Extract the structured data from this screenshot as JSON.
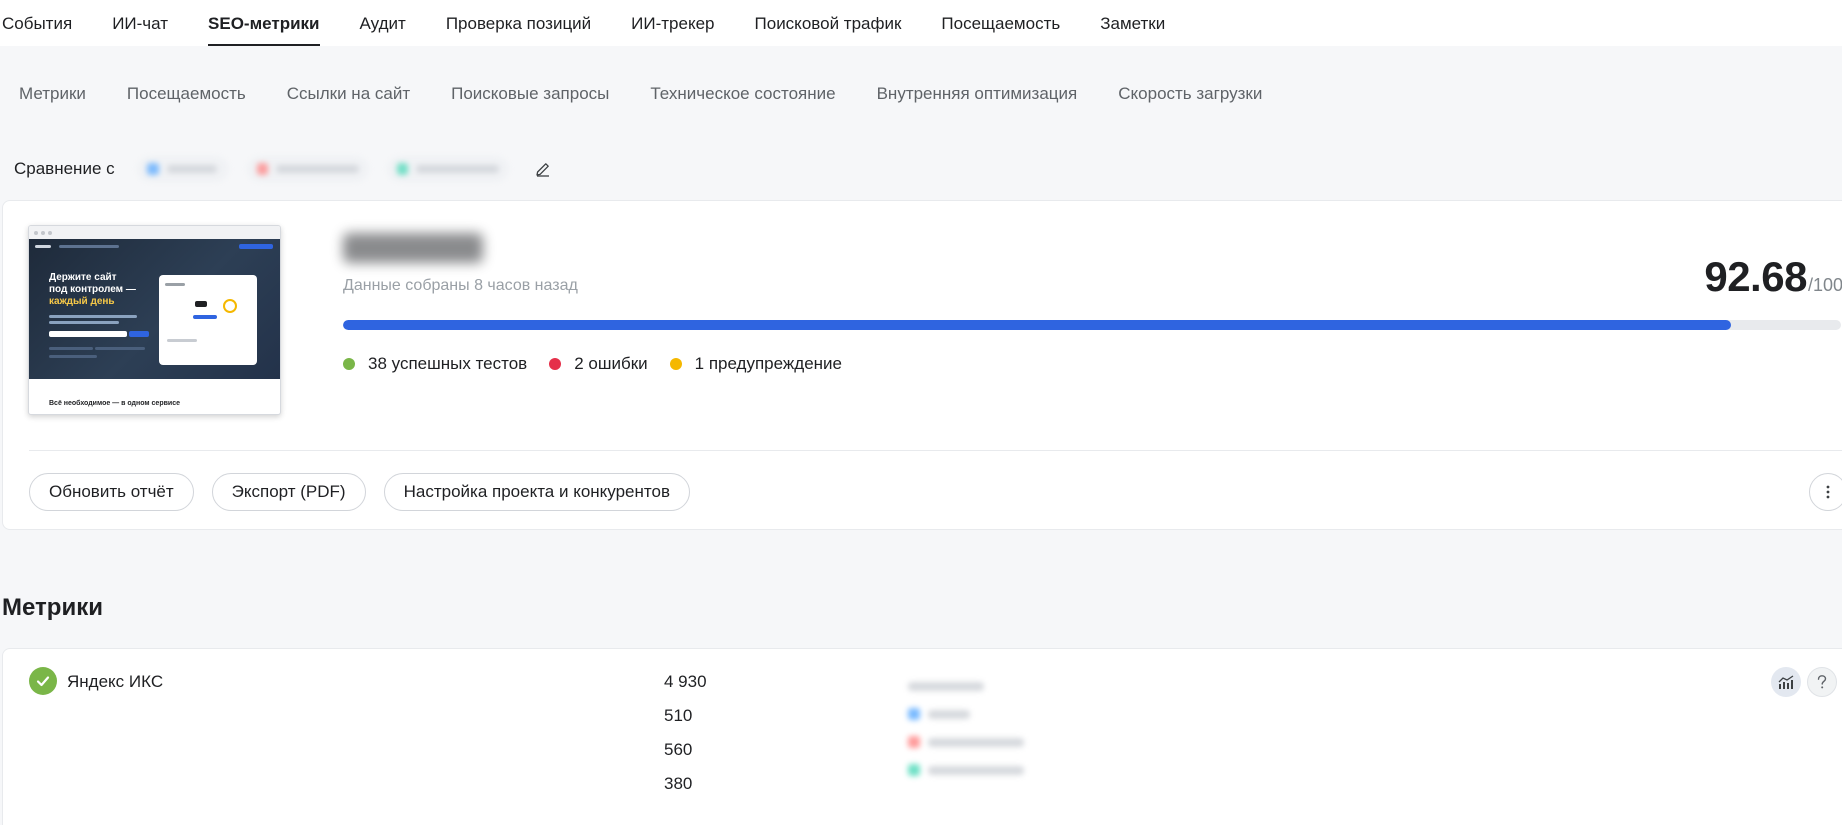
{
  "top_tabs": [
    {
      "label": "События"
    },
    {
      "label": "ИИ-чат"
    },
    {
      "label": "SEO-метрики",
      "active": true
    },
    {
      "label": "Аудит"
    },
    {
      "label": "Проверка позиций"
    },
    {
      "label": "ИИ-трекер"
    },
    {
      "label": "Поисковой трафик"
    },
    {
      "label": "Посещаемость"
    },
    {
      "label": "Заметки"
    }
  ],
  "sub_tabs": [
    {
      "label": "Метрики"
    },
    {
      "label": "Посещаемость"
    },
    {
      "label": "Ссылки на сайт"
    },
    {
      "label": "Поисковые запросы"
    },
    {
      "label": "Техническое состояние"
    },
    {
      "label": "Внутренняя оптимизация"
    },
    {
      "label": "Скорость загрузки"
    }
  ],
  "compare": {
    "label": "Сравнение с",
    "competitors": [
      {
        "color": "#4da3ff"
      },
      {
        "color": "#ff7a7a"
      },
      {
        "color": "#3fd6b3"
      }
    ]
  },
  "project": {
    "thumbnail": {
      "hero_title_line1": "Держите сайт",
      "hero_title_line2": "под контролем —",
      "hero_title_line3": "каждый день",
      "bottom_title": "Всё необходимое — в одном сервисе"
    },
    "collected": "Данные собраны 8 часов назад",
    "score": "92.68",
    "score_max": "/100",
    "score_fraction": 0.9268,
    "stats": [
      {
        "label": "38 успешных тестов",
        "color": "#7ab648"
      },
      {
        "label": "2 ошибки",
        "color": "#e5304a"
      },
      {
        "label": "1 предупреждение",
        "color": "#f5b800"
      }
    ],
    "actions": {
      "refresh": "Обновить отчёт",
      "export": "Экспорт (PDF)",
      "settings": "Настройка проекта и конкурентов"
    }
  },
  "metrics_section": {
    "title": "Метрики",
    "items": [
      {
        "name": "Яндекс ИКС",
        "values": [
          "4 930",
          "510",
          "560",
          "380"
        ],
        "site_colors": [
          "#c6c9ce",
          "#4da3ff",
          "#ff7a7a",
          "#3fd6b3"
        ]
      }
    ]
  },
  "colors": {
    "accent": "#2f64e0",
    "success": "#7ab648",
    "error": "#e5304a",
    "warning": "#f5b800"
  }
}
